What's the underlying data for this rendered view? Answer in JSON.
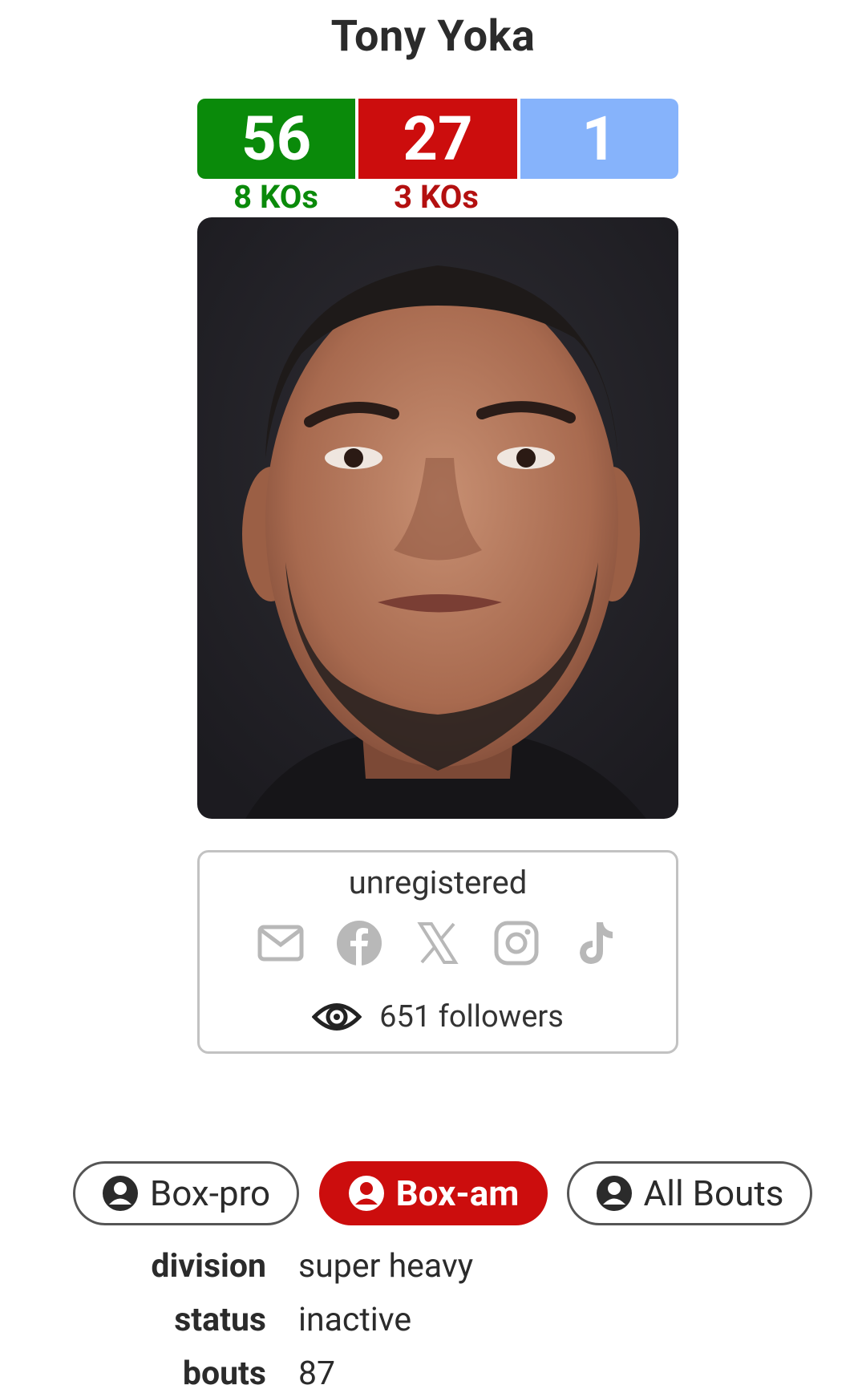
{
  "fighter": {
    "name": "Tony Yoka"
  },
  "record": {
    "wins": "56",
    "losses": "27",
    "draws": "1",
    "win_kos": "8 KOs",
    "loss_kos": "3 KOs"
  },
  "colors": {
    "win": "#0a8a0a",
    "loss": "#cc0d0d",
    "draw": "#86b3fb"
  },
  "social": {
    "status": "unregistered",
    "icons": [
      "mail-icon",
      "facebook-icon",
      "x-icon",
      "instagram-icon",
      "tiktok-icon"
    ],
    "followers": "651 followers"
  },
  "tabs": {
    "pro": "Box-pro",
    "am": "Box-am",
    "all": "All Bouts",
    "active": "Box-am"
  },
  "info": [
    {
      "label": "division",
      "value": "super heavy"
    },
    {
      "label": "status",
      "value": "inactive"
    },
    {
      "label": "bouts",
      "value": "87"
    }
  ]
}
